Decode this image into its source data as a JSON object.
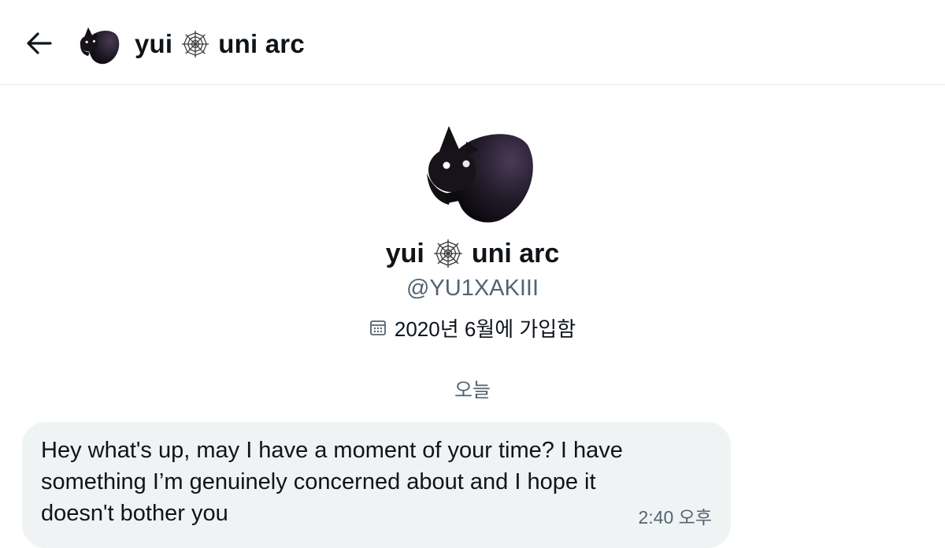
{
  "header": {
    "back_icon": "arrow-left-icon",
    "name_part1": "yui",
    "name_emoji": "spider-web-icon",
    "name_part2": "uni arc",
    "avatar_icon": "black-cat-avatar"
  },
  "profile": {
    "name_part1": "yui",
    "name_part2": "uni arc",
    "handle": "@YU1XAKIII",
    "joined_icon": "calendar-icon",
    "joined": "2020년 6월에 가입함"
  },
  "conversation": {
    "day_separator": "오늘",
    "messages": [
      {
        "text": "Hey what's up, may I have a moment of your time? I have something I’m genuinely concerned about and I hope it doesn't bother you",
        "time": "2:40 오후"
      }
    ]
  },
  "colors": {
    "text_primary": "#0f1419",
    "text_secondary": "#536471",
    "bubble_bg": "#eff3f4",
    "divider": "#e6e9eb"
  }
}
